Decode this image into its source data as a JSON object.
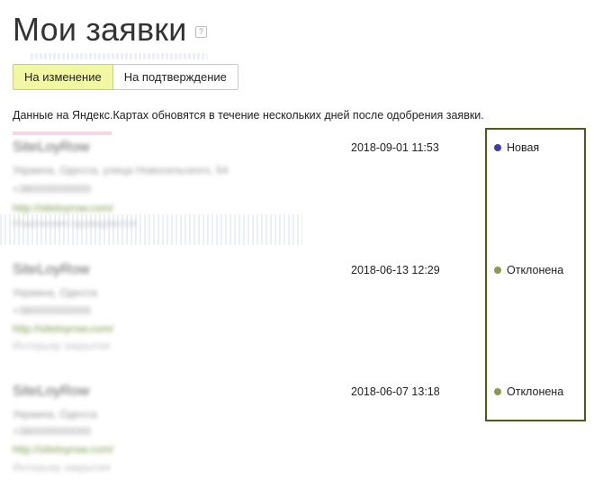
{
  "page": {
    "title": "Мои заявки",
    "help_icon": "?",
    "notice": "Данные на Яндекс.Картах обновятся в течение нескольких дней после одобрения заявки."
  },
  "tabs": [
    {
      "label": "На изменение",
      "active": true
    },
    {
      "label": "На подтверждение",
      "active": false
    }
  ],
  "requests": [
    {
      "name": "SiteLoyRow",
      "address": "Украина, Одесса, улица Новосельского, 54",
      "phone": "+380000000000",
      "url": "http://siteloyrow.com/",
      "note": "Изменения проверяются",
      "date": "2018-09-01 11:53",
      "status": "Новая",
      "status_color": "#3b3fae"
    },
    {
      "name": "SiteLoyRow",
      "address": "Украина, Одесса",
      "phone": "+380000000000",
      "url": "http://siteloyrow.com/",
      "note": "Интерьер закрытия",
      "date": "2018-06-13 12:29",
      "status": "Отклонена",
      "status_color": "#8a9a55"
    },
    {
      "name": "SiteLoyRow",
      "address": "Украина, Одесса",
      "phone": "+380000000000",
      "url": "http://siteloyrow.com/",
      "note": "Интерьер закрытия",
      "date": "2018-06-07 13:18",
      "status": "Отклонена",
      "status_color": "#8a9a55"
    }
  ]
}
